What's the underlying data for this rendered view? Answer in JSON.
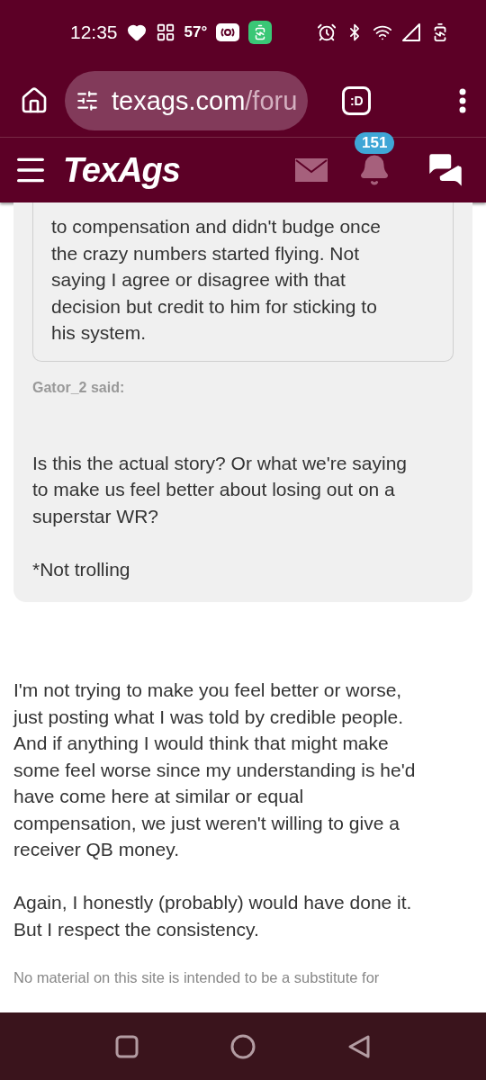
{
  "status_bar": {
    "time": "12:35",
    "temperature": "57°"
  },
  "browser": {
    "url_domain": "texags.com",
    "url_path": "/foru",
    "tab_button": ":D"
  },
  "site_header": {
    "logo": "TexAgs",
    "notification_count": "151"
  },
  "quote_panel": {
    "nested_quote_lines": [
      "to compensation and didn't budge once",
      "the crazy numbers started flying. Not",
      "saying I agree or disagree with that",
      "decision but credit to him for sticking to",
      "his system."
    ],
    "attribution": "Gator_2 said:",
    "paragraphs": [
      [
        "Is this the actual story? Or what we're saying",
        "to make us feel better about losing out on a",
        "superstar WR?"
      ],
      [
        "*Not trolling"
      ]
    ]
  },
  "post": {
    "paragraphs": [
      [
        "I'm not trying to make you feel better or worse,",
        "just posting what I was told by credible people.",
        "And if anything I would think that might make",
        "some feel worse since my understanding is he'd",
        "have come here at similar or equal",
        "compensation, we just weren't willing to give a",
        "receiver QB money."
      ],
      [
        "Again, I honestly (probably) would have done it.",
        "But I respect the consistency."
      ]
    ]
  },
  "footer": {
    "disclaimer": "No material on this site is intended to be a substitute for"
  }
}
